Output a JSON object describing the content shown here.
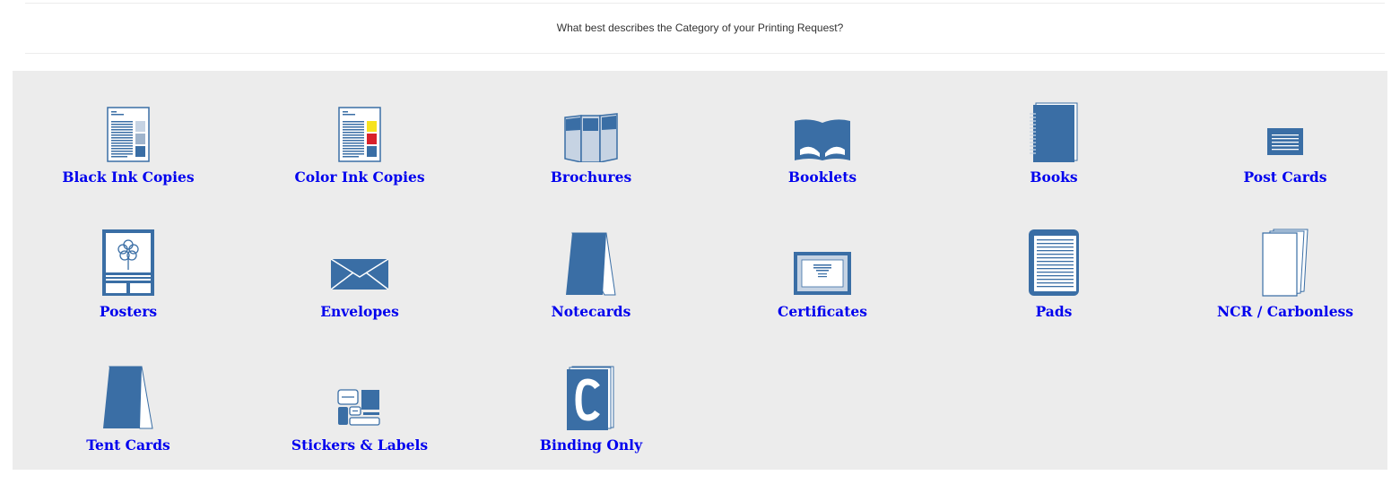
{
  "question": "What best describes the Category of your Printing Request?",
  "colors": {
    "icon_blue": "#3a6ea5",
    "icon_light": "#c6d3e3",
    "link": "#0000ee",
    "panel": "#ececec"
  },
  "categories": [
    {
      "label": "Black Ink Copies",
      "icon": "black-ink-document-icon"
    },
    {
      "label": "Color Ink Copies",
      "icon": "color-ink-document-icon"
    },
    {
      "label": "Brochures",
      "icon": "trifold-brochure-icon"
    },
    {
      "label": "Booklets",
      "icon": "open-booklet-icon"
    },
    {
      "label": "Books",
      "icon": "spiral-book-icon"
    },
    {
      "label": "Post Cards",
      "icon": "postcard-icon"
    },
    {
      "label": "Posters",
      "icon": "poster-icon"
    },
    {
      "label": "Envelopes",
      "icon": "envelope-icon"
    },
    {
      "label": "Notecards",
      "icon": "notecard-icon"
    },
    {
      "label": "Certificates",
      "icon": "certificate-icon"
    },
    {
      "label": "Pads",
      "icon": "notepad-icon"
    },
    {
      "label": "NCR / Carbonless",
      "icon": "carbonless-form-icon"
    },
    {
      "label": "Tent Cards",
      "icon": "tent-card-icon"
    },
    {
      "label": "Stickers & Labels",
      "icon": "stickers-labels-icon"
    },
    {
      "label": "Binding Only",
      "icon": "binding-icon"
    }
  ]
}
